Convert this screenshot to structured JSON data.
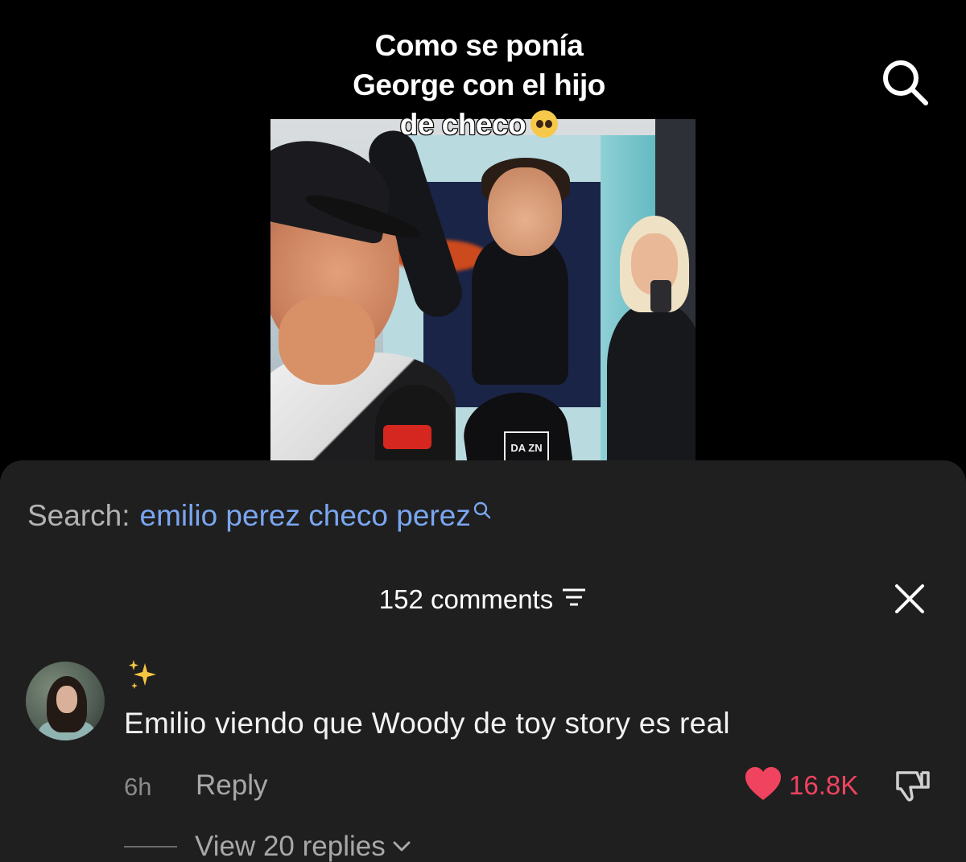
{
  "video": {
    "caption_line1": "Como se ponía",
    "caption_line2": "George con el hijo",
    "caption_line3": "de checo",
    "caption_emoji": "pleading-face-emoji",
    "mic_label": "DA ZN"
  },
  "top_bar": {
    "search_icon": "search-icon"
  },
  "comments_sheet": {
    "search_label": "Search:",
    "search_query": "emilio perez checo perez",
    "comment_count": "152 comments",
    "filter_icon": "filter-icon",
    "close_icon": "close-icon",
    "comments": [
      {
        "avatar_icon": "avatar",
        "username_icon": "sparkles-icon",
        "text": "Emilio viendo que Woody de toy story es real",
        "time": "6h",
        "reply_label": "Reply",
        "likes": "16.8K",
        "liked": true,
        "view_replies": "View 20 replies"
      }
    ]
  },
  "colors": {
    "background": "#000000",
    "sheet": "#1f1f1f",
    "link": "#7aa6f0",
    "like": "#f0435f",
    "muted": "#a8a8a8"
  }
}
